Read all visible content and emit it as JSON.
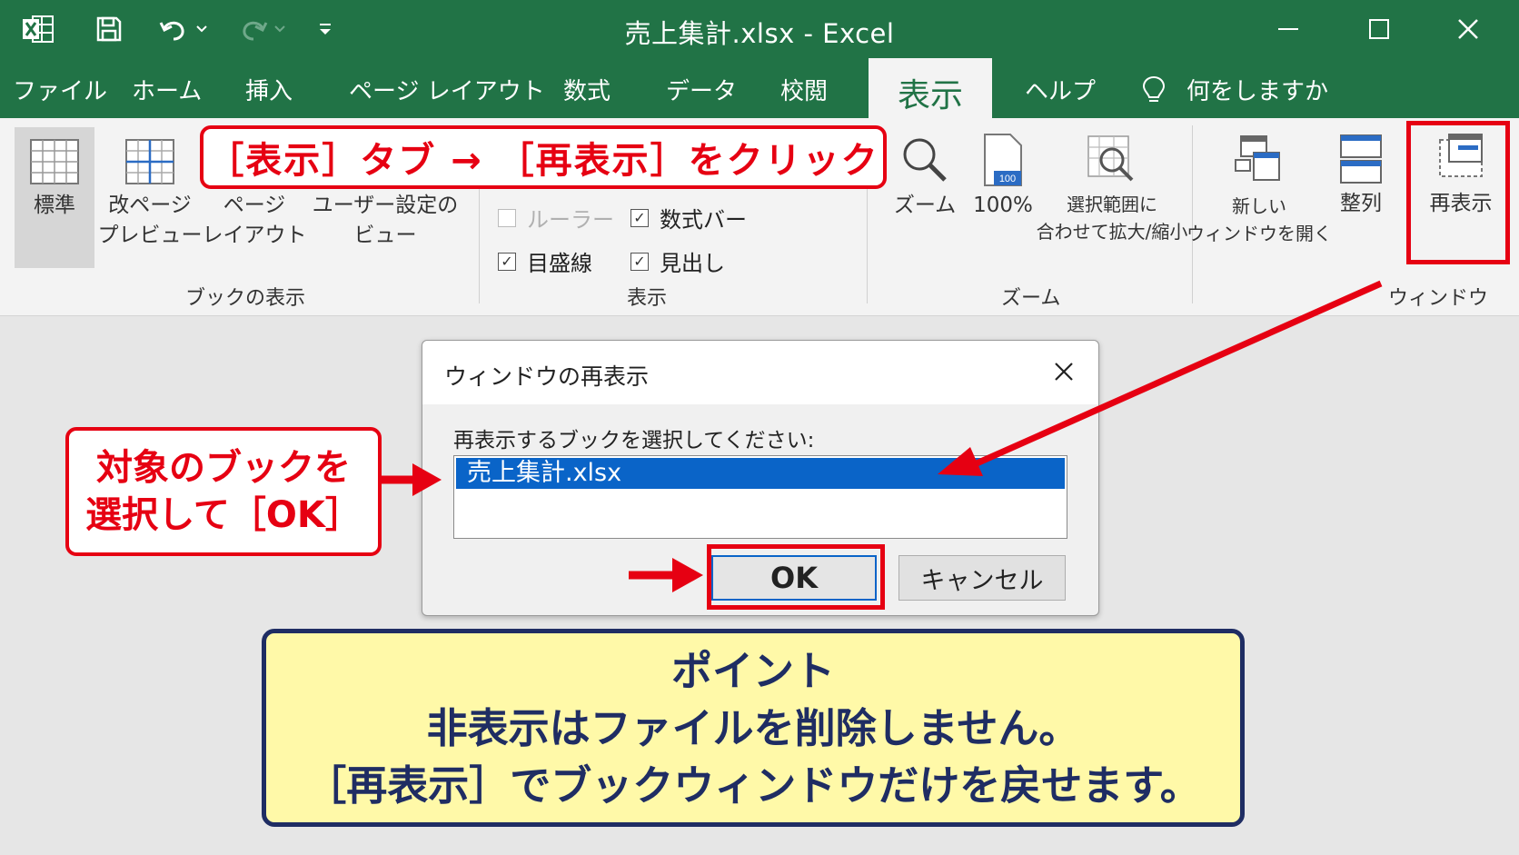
{
  "app": {
    "title": "売上集計.xlsx  -  Excel"
  },
  "tabs": [
    {
      "label": "ファイル"
    },
    {
      "label": "ホーム"
    },
    {
      "label": "挿入"
    },
    {
      "label": "ページ レイアウト"
    },
    {
      "label": "数式"
    },
    {
      "label": "データ"
    },
    {
      "label": "校閲"
    },
    {
      "label": "表示",
      "active": true
    },
    {
      "label": "ヘルプ"
    },
    {
      "label": "何をしますか"
    }
  ],
  "ribbon": {
    "book_view": {
      "group_label": "ブックの表示",
      "normal": "標準",
      "pagebreak_1": "改ページ",
      "pagebreak_2": "プレビュー",
      "pagelayout_1": "ページ",
      "pagelayout_2": "レイアウト",
      "custom_1": "ユーザー設定の",
      "custom_2": "ビュー"
    },
    "show": {
      "group_label": "表示",
      "ruler": "ルーラー",
      "formula_bar": "数式バー",
      "gridlines": "目盛線",
      "headings": "見出し"
    },
    "zoom": {
      "group_label": "ズーム",
      "zoom": "ズーム",
      "zoom100": "100%",
      "zoom_icon_text": "100",
      "fit_1": "選択範囲に",
      "fit_2": "合わせて拡大/縮小"
    },
    "window": {
      "group_label": "ウィンドウ",
      "new_1": "新しい",
      "new_2": "ウィンドウを開く",
      "arrange": "整列",
      "unhide": "再表示"
    }
  },
  "callouts": {
    "top": "［表示］タブ → ［再表示］をクリック",
    "left_1": "対象のブックを",
    "left_2": "選択して［OK］"
  },
  "dialog": {
    "title": "ウィンドウの再表示",
    "prompt": "再表示するブックを選択してください:",
    "item": "売上集計.xlsx",
    "ok": "OK",
    "cancel": "キャンセル"
  },
  "point": {
    "line1": "ポイント",
    "line2": "非表示はファイルを削除しません。",
    "line3": "［再表示］でブックウィンドウだけを戻せます。"
  },
  "colors": {
    "excel_green": "#217346",
    "accent_red": "#e60012",
    "selection_blue": "#0a64c8",
    "point_bg": "#fff9a8",
    "point_border": "#1f2d63"
  }
}
